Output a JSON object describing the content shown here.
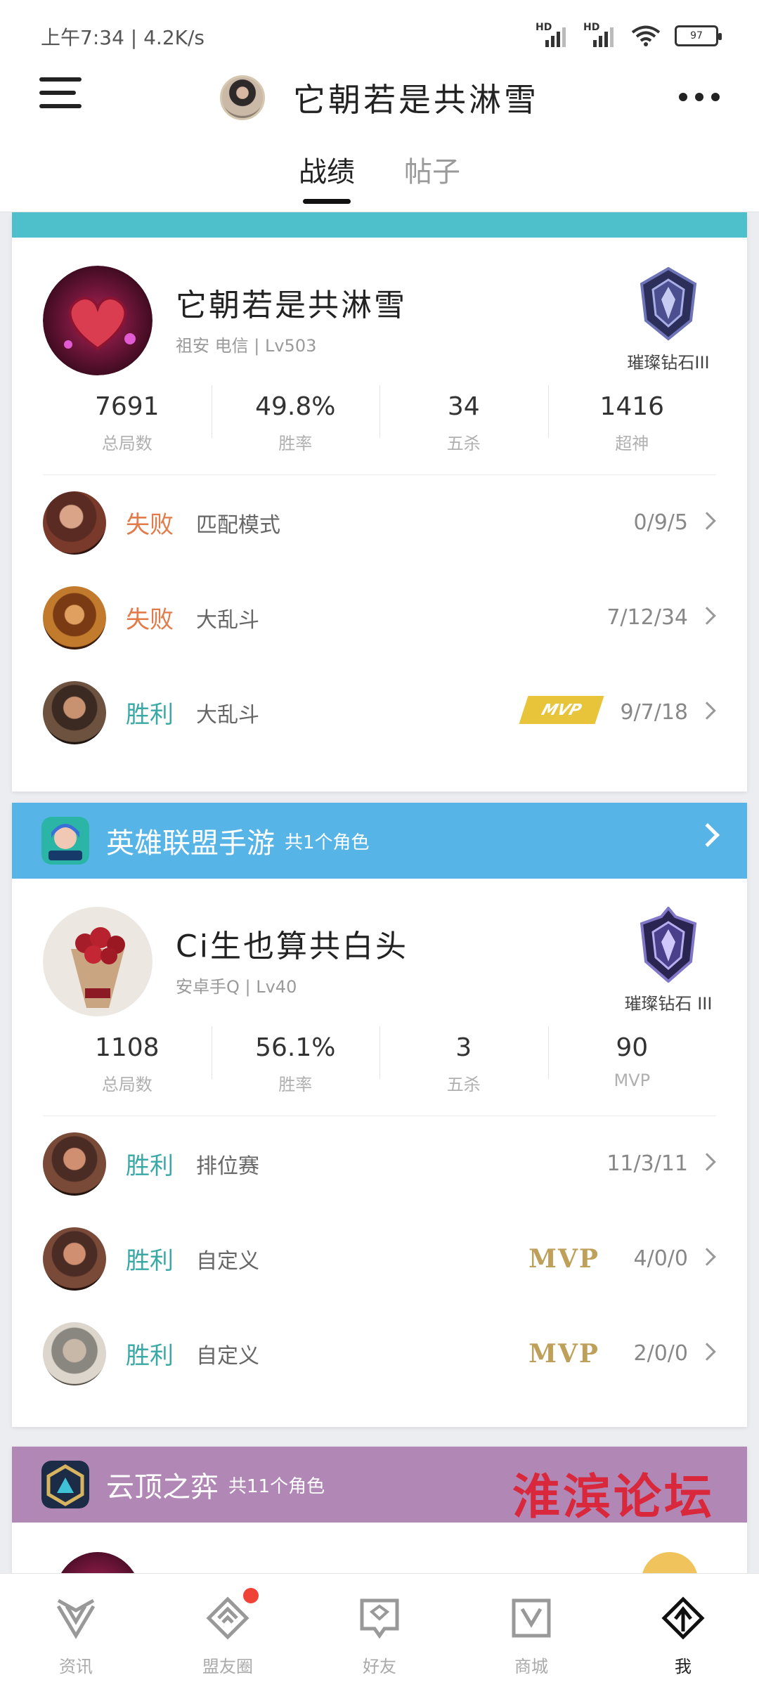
{
  "status_bar": {
    "time": "上午7:34 | 4.2K/s",
    "signal1_label": "HD",
    "signal2_label": "HD",
    "battery": "97"
  },
  "header": {
    "title": "它朝若是共淋雪",
    "tabs": [
      {
        "label": "战绩",
        "active": true
      },
      {
        "label": "帖子",
        "active": false
      }
    ]
  },
  "lol": {
    "player": {
      "name": "它朝若是共淋雪",
      "info": "祖安 电信 | Lv503",
      "rank": "璀璨钻石III"
    },
    "stats": [
      {
        "value": "7691",
        "label": "总局数"
      },
      {
        "value": "49.8%",
        "label": "胜率"
      },
      {
        "value": "34",
        "label": "五杀"
      },
      {
        "value": "1416",
        "label": "超神"
      }
    ],
    "matches": [
      {
        "result": "失败",
        "mode": "匹配模式",
        "kda": "0/9/5"
      },
      {
        "result": "失败",
        "mode": "大乱斗",
        "kda": "7/12/34"
      },
      {
        "result": "胜利",
        "mode": "大乱斗",
        "kda": "9/7/18",
        "mvp": "MVP"
      }
    ]
  },
  "mobile": {
    "band": {
      "name": "英雄联盟手游",
      "sub": "共1个角色"
    },
    "player": {
      "name": "Ci生也算共白头",
      "info": "安卓手Q | Lv40",
      "rank": "璀璨钻石 III"
    },
    "stats": [
      {
        "value": "1108",
        "label": "总局数"
      },
      {
        "value": "56.1%",
        "label": "胜率"
      },
      {
        "value": "3",
        "label": "五杀"
      },
      {
        "value": "90",
        "label": "MVP"
      }
    ],
    "matches": [
      {
        "result": "胜利",
        "mode": "排位赛",
        "kda": "11/3/11"
      },
      {
        "result": "胜利",
        "mode": "自定义",
        "kda": "4/0/0",
        "mvp": "MVP"
      },
      {
        "result": "胜利",
        "mode": "自定义",
        "kda": "2/0/0",
        "mvp": "MVP"
      }
    ]
  },
  "tft": {
    "band": {
      "name": "云顶之弈",
      "sub": "共11个角色"
    },
    "watermark": "淮滨论坛"
  },
  "bottom_nav": [
    {
      "label": "资讯"
    },
    {
      "label": "盟友圈"
    },
    {
      "label": "好友"
    },
    {
      "label": "商城"
    },
    {
      "label": "我"
    }
  ],
  "colors": {
    "lol_band": "#4ec0cb",
    "mobile_band": "#56b4e6",
    "tft_band": "#b187b6",
    "loss": "#e27a4a",
    "win": "#3aa9a6",
    "mvp_gold": "#bfa05a"
  }
}
